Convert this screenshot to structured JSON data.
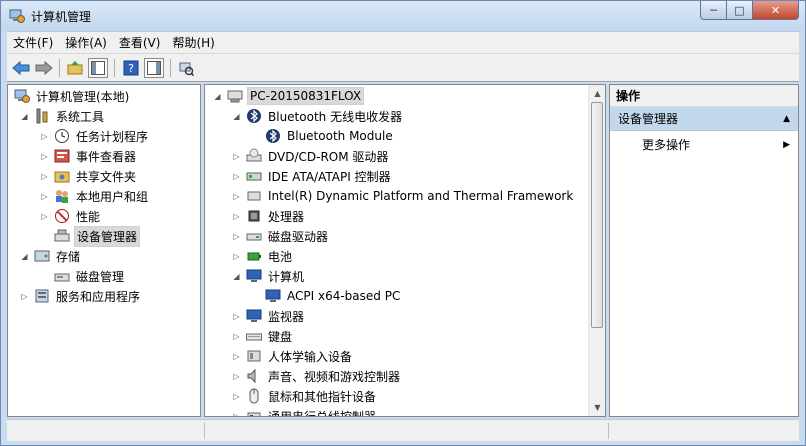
{
  "window": {
    "title": "计算机管理"
  },
  "menu": [
    "文件(F)",
    "操作(A)",
    "查看(V)",
    "帮助(H)"
  ],
  "left_tree": [
    {
      "label": "计算机管理(本地)",
      "icon": "computer-management-icon",
      "level": 0,
      "expander": ""
    },
    {
      "label": "系统工具",
      "icon": "tools-icon",
      "level": 1,
      "expander": "expanded"
    },
    {
      "label": "任务计划程序",
      "icon": "clock-icon",
      "level": 2,
      "expander": "collapsed"
    },
    {
      "label": "事件查看器",
      "icon": "event-viewer-icon",
      "level": 2,
      "expander": "collapsed"
    },
    {
      "label": "共享文件夹",
      "icon": "shared-folder-icon",
      "level": 2,
      "expander": "collapsed"
    },
    {
      "label": "本地用户和组",
      "icon": "users-icon",
      "level": 2,
      "expander": "collapsed"
    },
    {
      "label": "性能",
      "icon": "performance-icon",
      "level": 2,
      "expander": "collapsed"
    },
    {
      "label": "设备管理器",
      "icon": "device-manager-icon",
      "level": 2,
      "expander": "",
      "selected": true
    },
    {
      "label": "存储",
      "icon": "storage-icon",
      "level": 1,
      "expander": "expanded"
    },
    {
      "label": "磁盘管理",
      "icon": "disk-management-icon",
      "level": 2,
      "expander": ""
    },
    {
      "label": "服务和应用程序",
      "icon": "services-icon",
      "level": 1,
      "expander": "collapsed"
    }
  ],
  "device_tree": [
    {
      "label": "PC-20150831FLOX",
      "icon": "computer-icon",
      "level": 0,
      "expander": "expanded",
      "selected": true
    },
    {
      "label": "Bluetooth 无线电收发器",
      "icon": "bluetooth-icon",
      "level": 1,
      "expander": "expanded"
    },
    {
      "label": "Bluetooth Module",
      "icon": "bluetooth-icon",
      "level": 2,
      "expander": ""
    },
    {
      "label": "DVD/CD-ROM 驱动器",
      "icon": "dvd-drive-icon",
      "level": 1,
      "expander": "collapsed"
    },
    {
      "label": "IDE ATA/ATAPI 控制器",
      "icon": "ide-controller-icon",
      "level": 1,
      "expander": "collapsed"
    },
    {
      "label": "Intel(R) Dynamic Platform and Thermal Framework",
      "icon": "device-icon",
      "level": 1,
      "expander": "collapsed"
    },
    {
      "label": "处理器",
      "icon": "processor-icon",
      "level": 1,
      "expander": "collapsed"
    },
    {
      "label": "磁盘驱动器",
      "icon": "disk-drive-icon",
      "level": 1,
      "expander": "collapsed"
    },
    {
      "label": "电池",
      "icon": "battery-icon",
      "level": 1,
      "expander": "collapsed"
    },
    {
      "label": "计算机",
      "icon": "monitor-icon",
      "level": 1,
      "expander": "expanded"
    },
    {
      "label": "ACPI x64-based PC",
      "icon": "monitor-icon",
      "level": 2,
      "expander": ""
    },
    {
      "label": "监视器",
      "icon": "monitor-icon",
      "level": 1,
      "expander": "collapsed"
    },
    {
      "label": "键盘",
      "icon": "keyboard-icon",
      "level": 1,
      "expander": "collapsed"
    },
    {
      "label": "人体学输入设备",
      "icon": "hid-icon",
      "level": 1,
      "expander": "collapsed"
    },
    {
      "label": "声音、视频和游戏控制器",
      "icon": "speaker-icon",
      "level": 1,
      "expander": "collapsed"
    },
    {
      "label": "鼠标和其他指针设备",
      "icon": "mouse-icon",
      "level": 1,
      "expander": "collapsed"
    },
    {
      "label": "通用串行总线控制器",
      "icon": "usb-icon",
      "level": 1,
      "expander": "collapsed"
    }
  ],
  "actions": {
    "header": "操作",
    "section": "设备管理器",
    "items": [
      "更多操作"
    ]
  },
  "colors": {
    "titlebar": "#c9dbef",
    "selected_section": "#c4d8ed",
    "selected_item": "#d9d9d9"
  }
}
